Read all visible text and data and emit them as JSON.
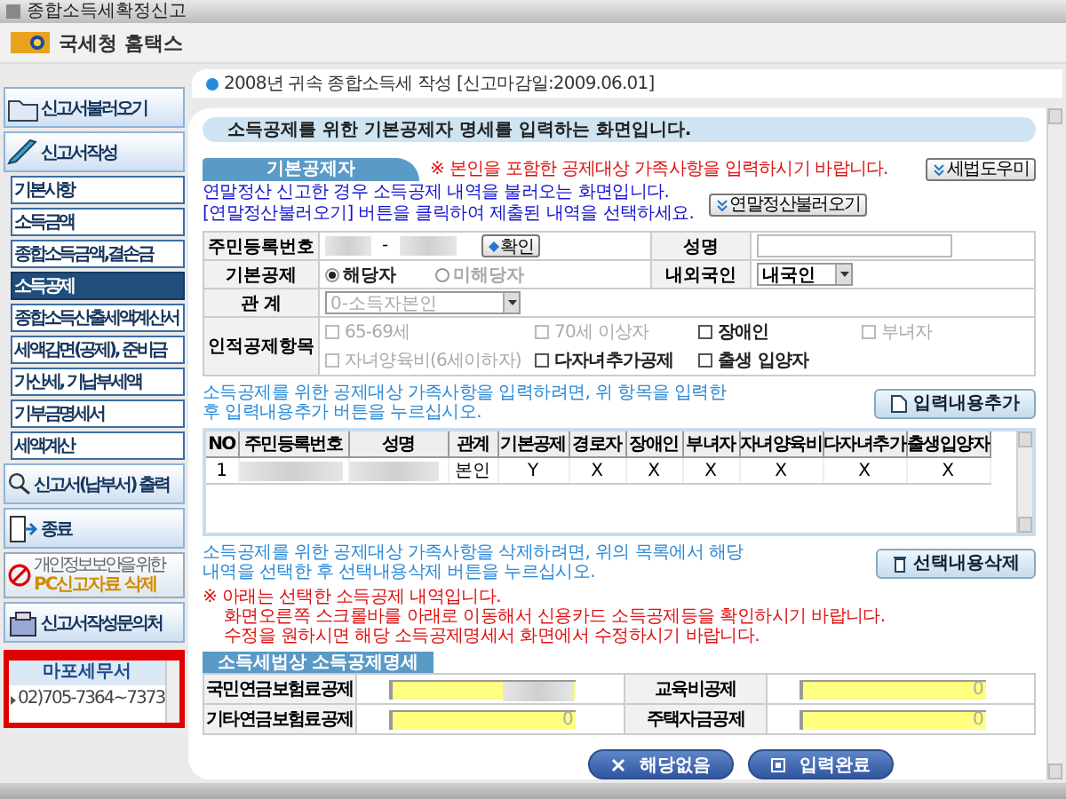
{
  "window": {
    "title": "종합소득세확정신고"
  },
  "header": {
    "brand": "국세청 홈택스"
  },
  "sidebar": {
    "items": [
      {
        "kind": "large",
        "label": "신고서불러오기",
        "selected": false
      },
      {
        "kind": "large",
        "label": "신고서작성",
        "selected": false
      },
      {
        "kind": "sub",
        "label": "기본사항",
        "selected": false
      },
      {
        "kind": "sub",
        "label": "소득금액",
        "selected": false
      },
      {
        "kind": "sub",
        "label": "종합소득금액,결손금",
        "selected": false
      },
      {
        "kind": "sub",
        "label": "소득공제",
        "selected": true
      },
      {
        "kind": "sub",
        "label": "종합소득산출세액계산서",
        "selected": false
      },
      {
        "kind": "sub",
        "label": "세액감면(공제), 준비금",
        "selected": false
      },
      {
        "kind": "sub",
        "label": "가산세, 기납부세액",
        "selected": false
      },
      {
        "kind": "sub",
        "label": "기부금명세서",
        "selected": false
      },
      {
        "kind": "sub",
        "label": "세액계산",
        "selected": false
      },
      {
        "kind": "large",
        "label": "신고서(납부서) 출력",
        "selected": false
      },
      {
        "kind": "large",
        "label": "종료",
        "selected": false
      },
      {
        "kind": "delete",
        "caption": "개인정보보안을 위한",
        "label": "PC신고자료 삭제",
        "selected": false
      },
      {
        "kind": "large",
        "label": "신고서작성문의처",
        "selected": false
      }
    ],
    "contact": {
      "office": "마포세무서",
      "phone": "02)705-7364~7373"
    }
  },
  "notice": "2008년 귀속 종합소득세 작성 [신고마감일:2009.06.01]",
  "banner": "소득공제를 위한 기본공제자 명세를 입력하는 화면입니다.",
  "section": {
    "title": "기본공제자",
    "warning": "※ 본인을 포함한 공제대상 가족사항을 입력하시기 바랍니다.",
    "help_button": "세법도우미"
  },
  "import": {
    "lines": [
      "연말정산 신고한 경우 소득공제 내역을 불러오는 화면입니다.",
      "[연말정산불러오기] 버튼을 클릭하여 제출된 내역을 선택하세요."
    ],
    "button": "연말정산불러오기"
  },
  "form": {
    "id_label": "주민등록번호",
    "id_separator": "-",
    "confirm_button": "확인",
    "name_label": "성명",
    "basic_label": "기본공제",
    "basic_options": [
      {
        "label": "해당자",
        "selected": true,
        "disabled": false
      },
      {
        "label": "미해당자",
        "selected": false,
        "disabled": true
      }
    ],
    "nationality_label": "내외국인",
    "nationality_value": "내국인",
    "relation_label": "관 계",
    "relation_value": "0-소득자본인",
    "personal_label": "인적공제항목",
    "personal_checks": [
      {
        "label": "65-69세",
        "checked": false,
        "disabled": true
      },
      {
        "label": "70세 이상자",
        "checked": false,
        "disabled": true
      },
      {
        "label": "장애인",
        "checked": false,
        "disabled": false
      },
      {
        "label": "부녀자",
        "checked": false,
        "disabled": true
      },
      {
        "label": "자녀양육비(6세이하자)",
        "checked": false,
        "disabled": true
      },
      {
        "label": "다자녀추가공제",
        "checked": false,
        "disabled": false
      },
      {
        "label": "출생 입양자",
        "checked": false,
        "disabled": false
      }
    ]
  },
  "add_hint": "소득공제를 위한 공제대상 가족사항을 입력하려면, 위 항목을 입력한 후 입력내용추가 버튼을 누르십시오.",
  "add_button": "입력내용추가",
  "family_table": {
    "columns": [
      "NO",
      "주민등록번호",
      "성명",
      "관계",
      "기본공제",
      "경로자",
      "장애인",
      "부녀자",
      "자녀양육비",
      "다자녀추가",
      "출생입양자"
    ],
    "rows": [
      {
        "no": "1",
        "relation": "본인",
        "flags": [
          "Y",
          "X",
          "X",
          "X",
          "X",
          "X",
          "X"
        ]
      }
    ]
  },
  "delete_hint": "소득공제를 위한 공제대상 가족사항을 삭제하려면, 위의 목록에서 해당내역을 선택한 후 선택내용삭제 버튼을 누르십시오.",
  "delete_button": "선택내용삭제",
  "notes": [
    "※ 아래는 선택한 소득공제 내역입니다.",
    "화면오른쪽 스크롤바를 아래로 이동해서 신용카드 소득공제등을 확인하시기 바랍니다.",
    "수정을 원하시면 해당 소득공제명세서 화면에서 수정하시기 바랍니다."
  ],
  "deductions": {
    "title": "소득세법상 소득공제명세",
    "items": [
      {
        "label": "국민연금보험료공제",
        "blurred": true
      },
      {
        "label": "교육비공제",
        "value": "0"
      },
      {
        "label": "기타연금보험료공제",
        "value": "0"
      },
      {
        "label": "주택자금공제",
        "value": "0"
      }
    ]
  },
  "footer_buttons": [
    {
      "kind": "cancel",
      "label": "해당없음"
    },
    {
      "kind": "done",
      "label": "입력완료"
    }
  ]
}
